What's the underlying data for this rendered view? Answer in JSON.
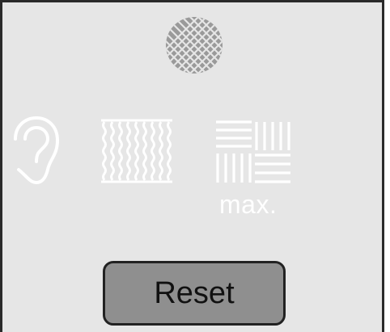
{
  "panel": {
    "max_label": "max.",
    "reset_label": "Reset"
  },
  "icons": {
    "top": "fabric-mesh-icon",
    "left": "ear-icon",
    "middle": "corrugated-panel-icon",
    "right": "parquet-panel-icon"
  },
  "colors": {
    "screen_background": "#e6e6e6",
    "icon_dim": "#9a9a9a",
    "icon_active": "#ffffff",
    "button_background": "#8f8f8f",
    "frame": "#2a2a2a"
  }
}
